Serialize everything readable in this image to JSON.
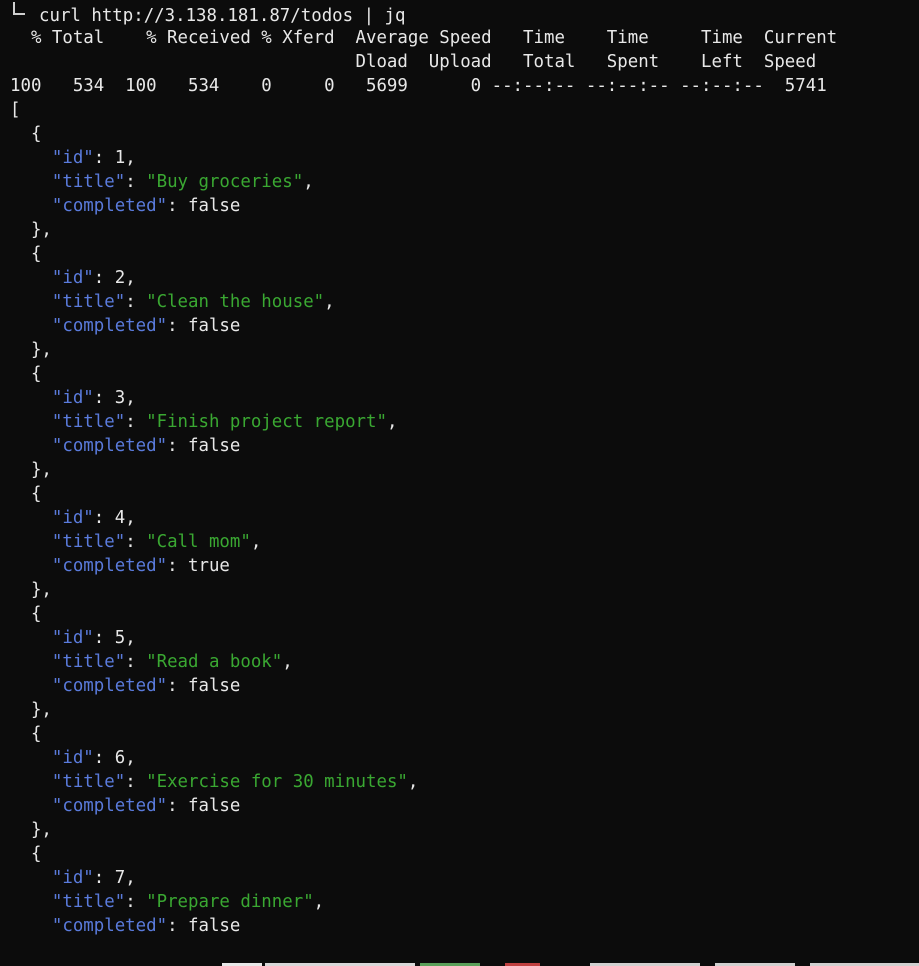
{
  "terminal": {
    "command": "curl http://3.138.181.87/todos | jq",
    "progress_header_1": "  % Total    % Received % Xferd  Average Speed   Time    Time     Time  Current",
    "progress_header_2": "                                 Dload  Upload   Total   Spent    Left  Speed",
    "progress_values": "100   534  100   534    0     0   5699      0 --:--:-- --:--:-- --:--:--  5741",
    "open_bracket": "[",
    "todos": [
      {
        "id": "1",
        "title": "\"Buy groceries\"",
        "completed": "false"
      },
      {
        "id": "2",
        "title": "\"Clean the house\"",
        "completed": "false"
      },
      {
        "id": "3",
        "title": "\"Finish project report\"",
        "completed": "false"
      },
      {
        "id": "4",
        "title": "\"Call mom\"",
        "completed": "true"
      },
      {
        "id": "5",
        "title": "\"Read a book\"",
        "completed": "false"
      },
      {
        "id": "6",
        "title": "\"Exercise for 30 minutes\"",
        "completed": "false"
      },
      {
        "id": "7",
        "title": "\"Prepare dinner\"",
        "completed": "false"
      }
    ],
    "keys": {
      "id": "\"id\"",
      "title": "\"title\"",
      "completed": "\"completed\""
    }
  },
  "colors": {
    "background": "#0c0c0c",
    "key": "#5a7bdc",
    "string": "#3aa832",
    "text": "#e8e8e8"
  }
}
